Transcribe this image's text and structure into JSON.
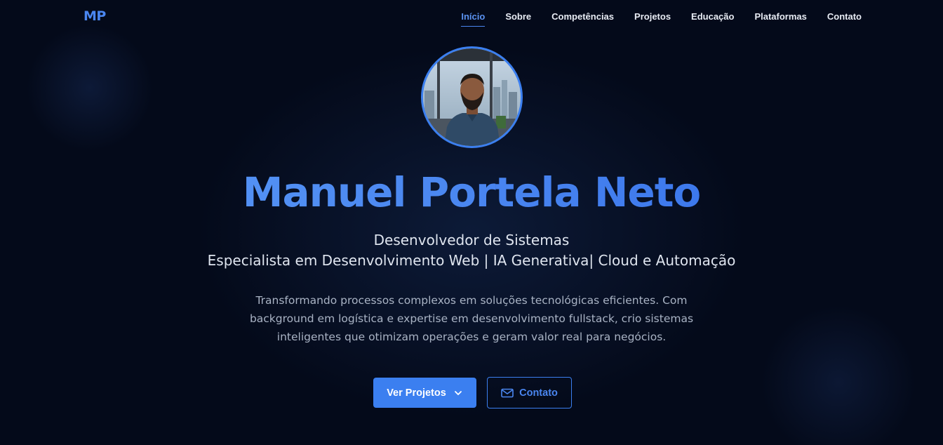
{
  "nav": {
    "logo": "MP",
    "items": [
      {
        "label": "Início",
        "active": true
      },
      {
        "label": "Sobre"
      },
      {
        "label": "Competências"
      },
      {
        "label": "Projetos"
      },
      {
        "label": "Educação"
      },
      {
        "label": "Plataformas"
      },
      {
        "label": "Contato"
      }
    ]
  },
  "hero": {
    "name": "Manuel Portela Neto",
    "role_line1": "Desenvolvedor de Sistemas",
    "role_line2": "Especialista em Desenvolvimento Web | IA Generativa| Cloud e Automação",
    "description": "Transformando processos complexos em soluções tecnológicas eficientes. Com background em logística e expertise em desenvolvimento fullstack, crio sistemas inteligentes que otimizam operações e geram valor real para negócios.",
    "primary_button": "Ver Projetos",
    "secondary_button": "Contato"
  },
  "icons": {
    "primary_button_icon": "chevron-down-icon",
    "secondary_button_icon": "mail-icon"
  },
  "colors": {
    "accent": "#3b7ff0",
    "background": "#040a1a"
  }
}
